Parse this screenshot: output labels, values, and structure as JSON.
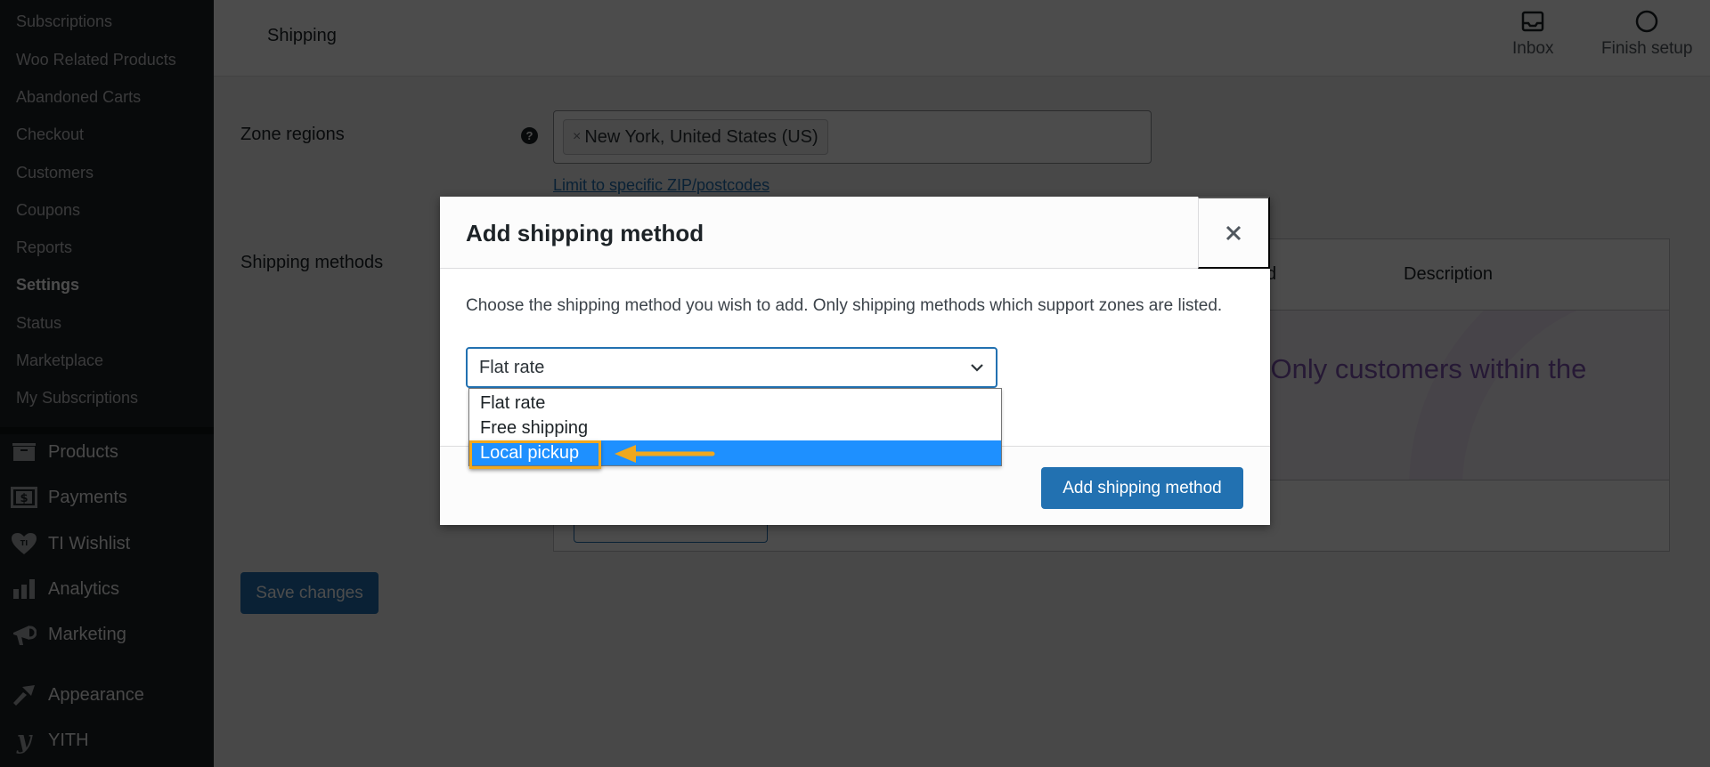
{
  "sidebar": {
    "sub_items": [
      {
        "label": "Subscriptions"
      },
      {
        "label": "Woo Related Products"
      },
      {
        "label": "Abandoned Carts"
      },
      {
        "label": "Checkout"
      },
      {
        "label": "Customers"
      },
      {
        "label": "Coupons"
      },
      {
        "label": "Reports"
      },
      {
        "label": "Settings",
        "active": true
      },
      {
        "label": "Status"
      },
      {
        "label": "Marketplace"
      },
      {
        "label": "My Subscriptions"
      }
    ],
    "main_items": [
      {
        "label": "Products",
        "icon": "archive-icon"
      },
      {
        "label": "Payments",
        "icon": "dollar-icon"
      },
      {
        "label": "TI Wishlist",
        "icon": "heart-icon"
      },
      {
        "label": "Analytics",
        "icon": "bar-chart-icon"
      },
      {
        "label": "Marketing",
        "icon": "megaphone-icon"
      },
      {
        "label": "Appearance",
        "icon": "paintbrush-icon"
      },
      {
        "label": "YITH",
        "icon": "yith-icon"
      }
    ]
  },
  "header": {
    "title": "Shipping",
    "inbox_label": "Inbox",
    "finish_setup_label": "Finish setup"
  },
  "zone": {
    "regions_label": "Zone regions",
    "help": "?",
    "region_tag": "New York, United States (US)",
    "region_tag_remove": "×",
    "limit_link": "Limit to specific ZIP/postcodes",
    "methods_label": "Shipping methods",
    "table_col_method_partial": "d",
    "table_col_description": "Description",
    "empty_text_partial": "e. Only customers within the"
  },
  "save_button": "Save changes",
  "modal": {
    "title": "Add shipping method",
    "close": "×",
    "description": "Choose the shipping method you wish to add. Only shipping methods which support zones are listed.",
    "select_value": "Flat rate",
    "options": [
      {
        "label": "Flat rate"
      },
      {
        "label": "Free shipping"
      },
      {
        "label": "Local pickup",
        "highlighted": true
      }
    ],
    "submit_label": "Add shipping method"
  },
  "colors": {
    "accent": "#2271b1",
    "highlight": "#1e90ff",
    "annotation": "#f0a81e",
    "sidebar_bg": "#1d2327"
  }
}
